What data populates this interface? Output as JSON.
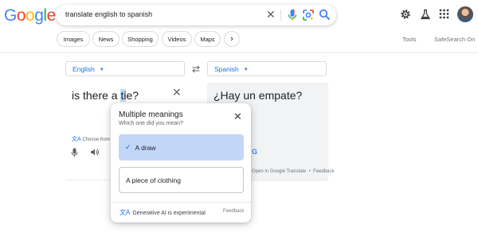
{
  "header": {
    "logo_letters": [
      {
        "ch": "G",
        "color": "#4285f4"
      },
      {
        "ch": "o",
        "color": "#ea4335"
      },
      {
        "ch": "o",
        "color": "#fbbc05"
      },
      {
        "ch": "g",
        "color": "#4285f4"
      },
      {
        "ch": "l",
        "color": "#34a853"
      },
      {
        "ch": "e",
        "color": "#ea4335"
      }
    ],
    "search_query": "translate english to spanish",
    "clear_icon": "close-icon",
    "icons": [
      "settings-icon",
      "labs-icon",
      "apps-grid-icon"
    ]
  },
  "chips": [
    {
      "label": "Images"
    },
    {
      "label": "News"
    },
    {
      "label": "Shopping"
    },
    {
      "label": "Videos"
    },
    {
      "label": "Maps"
    },
    {
      "label": "›"
    }
  ],
  "tools": {
    "tools_label": "Tools",
    "safesearch_label": "SafeSearch On"
  },
  "translate": {
    "source_lang": "English",
    "target_lang": "Spanish",
    "source_text_before": "is there a ",
    "source_text_highlight": "ti",
    "source_text_after": "e?",
    "target_text": "¿Hay un empate?",
    "choose_from": "Choose from",
    "open_in": "Open in Google Translate",
    "feedback": "Feedback"
  },
  "popup": {
    "title": "Multiple meanings",
    "subtitle": "Which one did you mean?",
    "options": [
      {
        "label": "A draw",
        "selected": true
      },
      {
        "label": "A piece of clothing",
        "selected": false
      }
    ],
    "ai_note": "Generative AI is experimental",
    "feedback": "Feedback"
  },
  "colors": {
    "accent": "#1a73e8",
    "selected_option_bg": "#c2d7f7"
  }
}
